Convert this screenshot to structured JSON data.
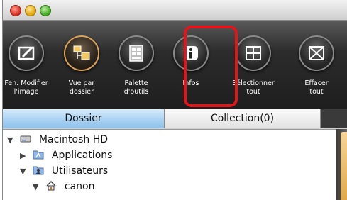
{
  "window": {
    "traffic_lights": [
      "close",
      "minimize",
      "zoom"
    ]
  },
  "toolbar": {
    "items": [
      {
        "label": "Fen. Modifier\nl'image",
        "icon": "edit-image-icon"
      },
      {
        "label": "Vue par\ndossier",
        "icon": "folder-view-icon",
        "selected": true
      },
      {
        "label": "Palette\nd'outils",
        "icon": "tool-palette-icon"
      },
      {
        "label": "Infos",
        "icon": "info-icon",
        "highlighted": true
      },
      {
        "label": "Sélectionner\ntout",
        "icon": "select-all-icon"
      },
      {
        "label": "Effacer\ntout",
        "icon": "clear-all-icon"
      }
    ],
    "highlight_color": "#e4141b"
  },
  "tabs": [
    {
      "label": "Dossier",
      "active": true
    },
    {
      "label": "Collection(0)",
      "active": false
    }
  ],
  "tree": [
    {
      "label": "Macintosh HD",
      "icon": "hard-drive-icon",
      "expanded": true,
      "level": 0
    },
    {
      "label": "Applications",
      "icon": "applications-folder-icon",
      "expanded": false,
      "level": 1
    },
    {
      "label": "Utilisateurs",
      "icon": "users-folder-icon",
      "expanded": true,
      "level": 1
    },
    {
      "label": "canon",
      "icon": "home-icon",
      "expanded": true,
      "level": 2
    }
  ]
}
